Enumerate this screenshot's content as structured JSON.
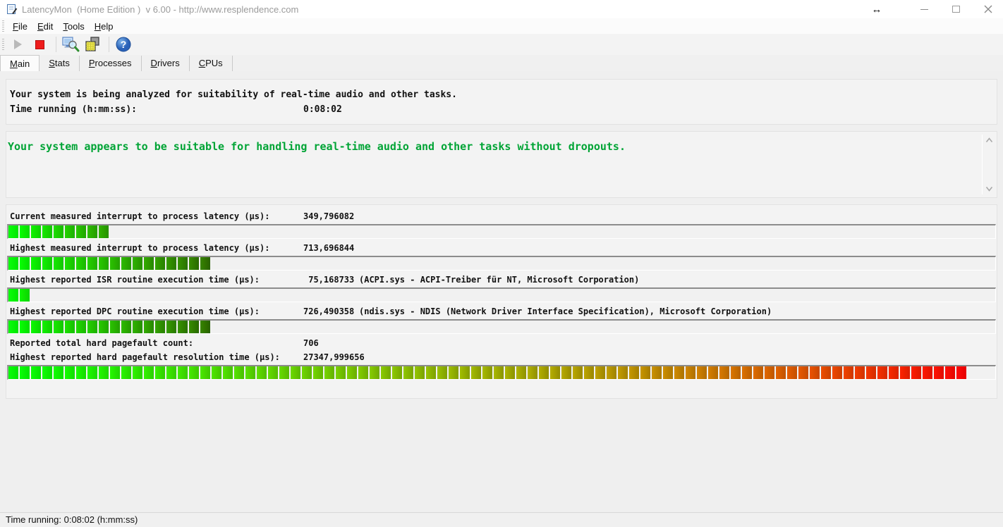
{
  "window": {
    "title": "LatencyMon  (Home Edition )  v 6.00 - http://www.resplendence.com",
    "controls": [
      {
        "name": "resize-handle",
        "glyph": "↔"
      },
      {
        "name": "minimize",
        "glyph": "–"
      },
      {
        "name": "maximize",
        "glyph": "□"
      },
      {
        "name": "close",
        "glyph": "✕"
      }
    ]
  },
  "menu": {
    "items": [
      {
        "label": "File"
      },
      {
        "label": "Edit"
      },
      {
        "label": "Tools"
      },
      {
        "label": "Help"
      }
    ]
  },
  "toolbar": {
    "buttons": [
      {
        "name": "start",
        "icon": "play-icon",
        "enabled": false
      },
      {
        "name": "stop",
        "icon": "stop-icon",
        "enabled": true
      },
      {
        "name": "analyze",
        "icon": "computer-magnifier-icon",
        "enabled": true
      },
      {
        "name": "copy-report",
        "icon": "layers-icon",
        "enabled": true
      },
      {
        "name": "help",
        "icon": "question-mark-icon",
        "enabled": true
      }
    ]
  },
  "tabs": [
    {
      "label": "Main",
      "active": true
    },
    {
      "label": "Stats",
      "active": false
    },
    {
      "label": "Processes",
      "active": false
    },
    {
      "label": "Drivers",
      "active": false
    },
    {
      "label": "CPUs",
      "active": false
    }
  ],
  "info": {
    "line1": "Your system is being analyzed for suitability of real-time audio and other tasks.",
    "time_label": "Time running (h:mm:ss):",
    "time_value": "0:08:02"
  },
  "alert": {
    "message": "Your system appears to be suitable for handling real-time audio and other tasks without dropouts.",
    "color": "#00a435"
  },
  "metrics": [
    {
      "label": "Current measured interrupt to process latency (µs):",
      "value": "349,796082",
      "extra": "",
      "bar": {
        "segments": 9,
        "max_segments": 85,
        "style": "green"
      }
    },
    {
      "label": "Highest measured interrupt to process latency (µs):",
      "value": "713,696844",
      "extra": "",
      "bar": {
        "segments": 18,
        "max_segments": 85,
        "style": "green"
      }
    },
    {
      "label": "Highest reported ISR routine execution time (µs):",
      "value": " 75,168733",
      "extra": "(ACPI.sys - ACPI-Treiber für NT, Microsoft Corporation)",
      "bar": {
        "segments": 2,
        "max_segments": 85,
        "style": "green"
      }
    },
    {
      "label": "Highest reported DPC routine execution time (µs):",
      "value": "726,490358",
      "extra": "(ndis.sys - NDIS (Network Driver Interface Specification), Microsoft Corporation)",
      "bar": {
        "segments": 18,
        "max_segments": 85,
        "style": "green"
      }
    },
    {
      "label": "Reported total hard pagefault count:",
      "value": "706",
      "extra": "",
      "bar": null
    },
    {
      "label": "Highest reported hard pagefault resolution time (µs):",
      "value": "27347,999656",
      "extra": "",
      "bar": {
        "segments": 85,
        "max_segments": 85,
        "style": "full"
      }
    }
  ],
  "statusbar": {
    "text": "Time running: 0:08:02  (h:mm:ss)"
  },
  "colors": {
    "bar_green_start": "#00f500",
    "bar_green_dark": "#2e7800",
    "bar_red_end": "#f50000",
    "alert_green": "#00a435",
    "stop_red": "#ee1c1c"
  }
}
